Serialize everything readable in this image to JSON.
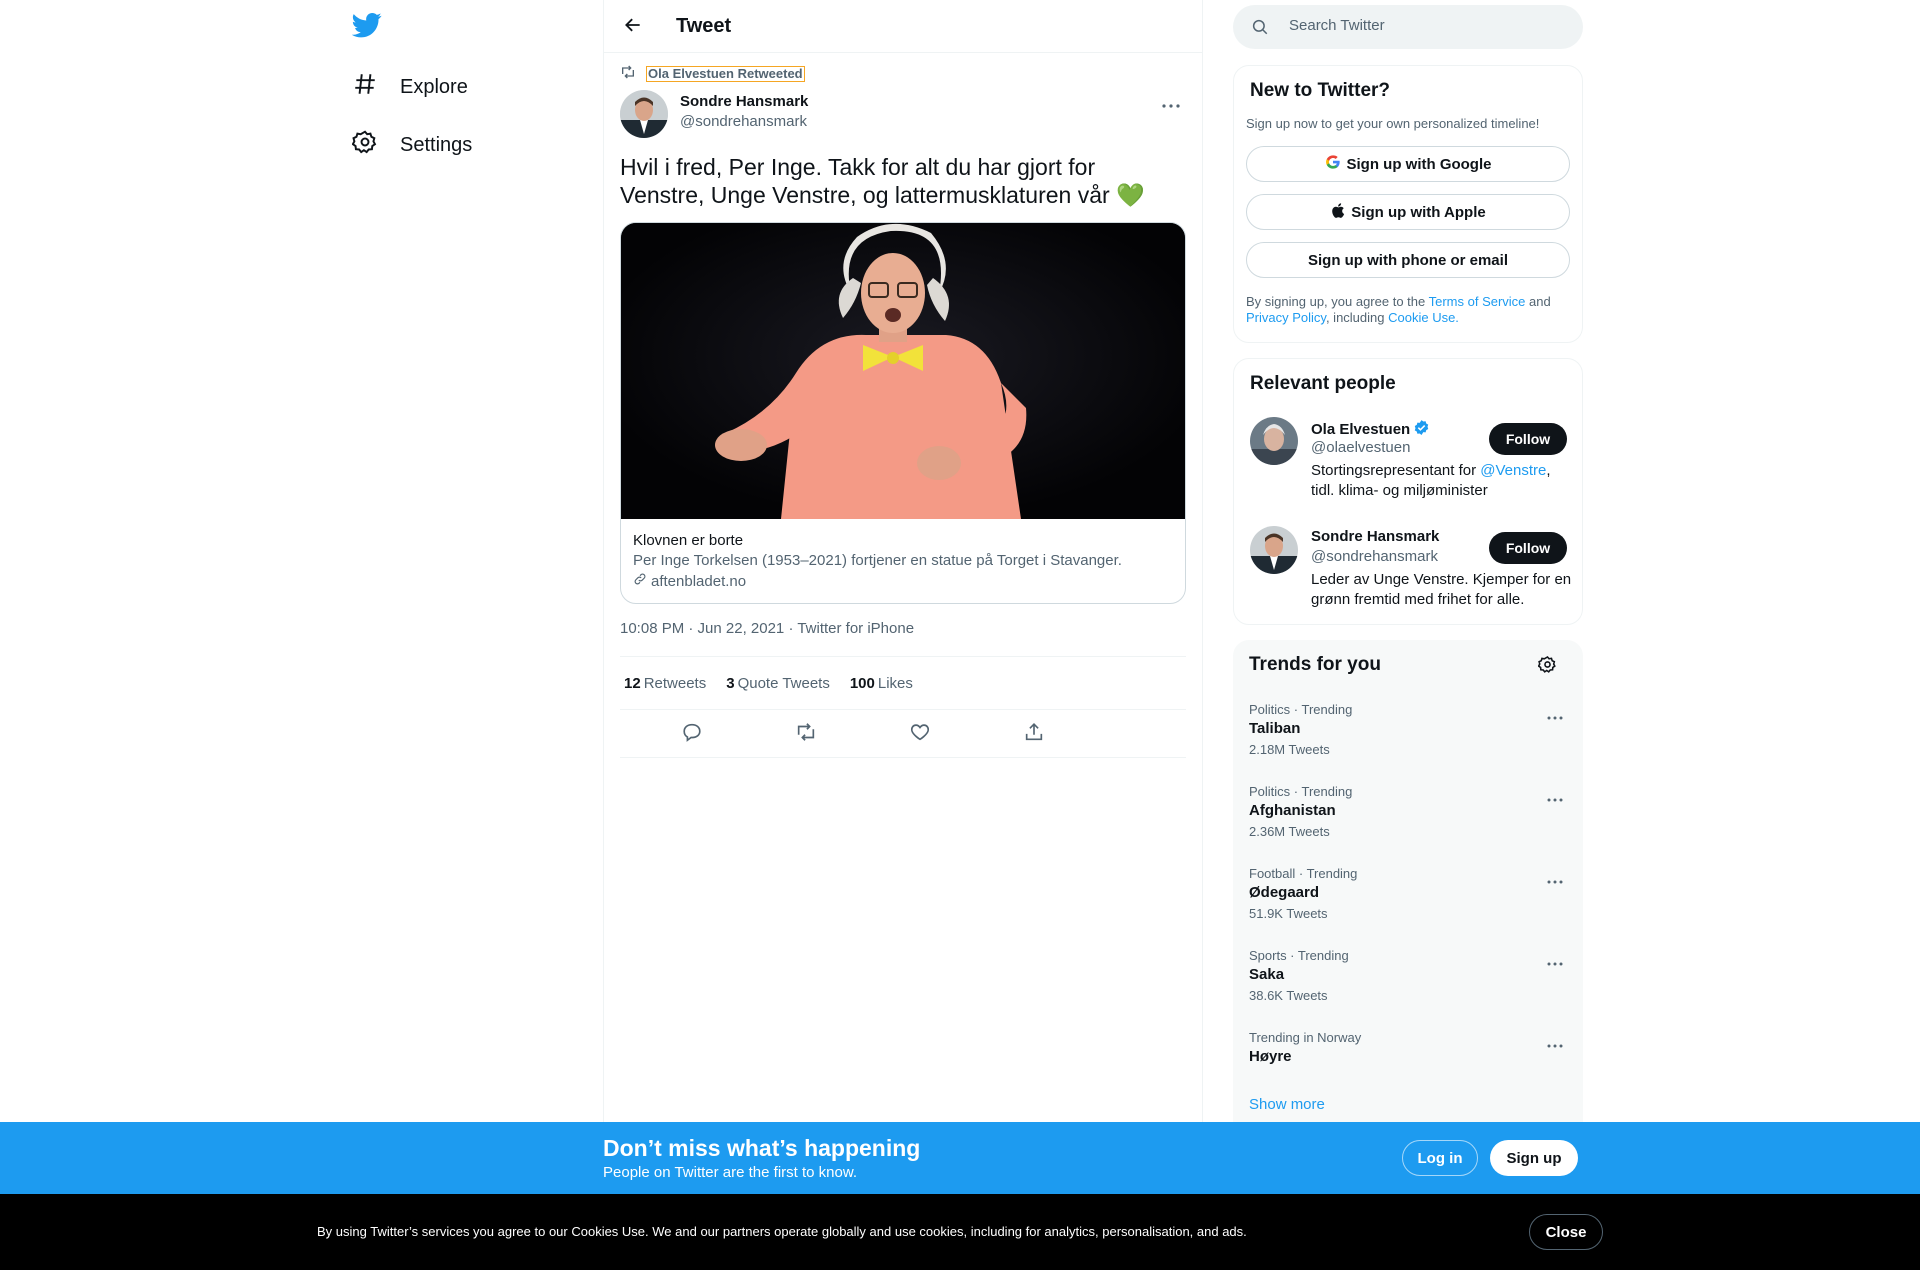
{
  "nav": {
    "explore_label": "Explore",
    "settings_label": "Settings"
  },
  "header": {
    "title": "Tweet"
  },
  "tweet": {
    "retweeted_by": "Ola Elvestuen Retweeted",
    "author_name": "Sondre Hansmark",
    "author_handle": "@sondrehansmark",
    "text": "Hvil i fred, Per Inge. Takk for alt du har gjort for Venstre, Unge Venstre, og lattermusklaturen vår",
    "emoji": "💚",
    "card": {
      "title": "Klovnen er borte",
      "description": "Per Inge Torkelsen (1953–2021) fortjener en statue på Torget i Stavanger.",
      "domain": "aftenbladet.no"
    },
    "timestamp": "10:08 PM · Jun 22, 2021 · Twitter for iPhone",
    "stats": {
      "retweets_count": "12",
      "retweets_label": "Retweets",
      "quotes_count": "3",
      "quotes_label": "Quote Tweets",
      "likes_count": "100",
      "likes_label": "Likes"
    }
  },
  "search": {
    "placeholder": "Search Twitter"
  },
  "new_to_twitter": {
    "title": "New to Twitter?",
    "subtitle": "Sign up now to get your own personalized timeline!",
    "google_btn": "Sign up with Google",
    "apple_btn": "Sign up with Apple",
    "phone_btn": "Sign up with phone or email",
    "terms_pre": "By signing up, you agree to the ",
    "terms_link": "Terms of Service",
    "terms_and": " and",
    "privacy_link": "Privacy Policy",
    "including": ", including ",
    "cookie_link": "Cookie Use."
  },
  "relevant_people": {
    "title": "Relevant people",
    "people": [
      {
        "name": "Ola Elvestuen",
        "handle": "@olaelvestuen",
        "bio_pre": "Stortingsrepresentant for ",
        "bio_link": "@Venstre",
        "bio_post": ", tidl. klima- og miljøminister",
        "follow": "Follow"
      },
      {
        "name": "Sondre Hansmark",
        "handle": "@sondrehansmark",
        "bio": "Leder av Unge Venstre. Kjemper for en grønn fremtid med frihet for alle.",
        "follow": "Follow"
      }
    ]
  },
  "trends": {
    "title": "Trends for you",
    "items": [
      {
        "meta": "Politics · Trending",
        "name": "Taliban",
        "count": "2.18M Tweets"
      },
      {
        "meta": "Politics · Trending",
        "name": "Afghanistan",
        "count": "2.36M Tweets"
      },
      {
        "meta": "Football · Trending",
        "name": "Ødegaard",
        "count": "51.9K Tweets"
      },
      {
        "meta": "Sports · Trending",
        "name": "Saka",
        "count": "38.6K Tweets"
      },
      {
        "meta": "Trending in Norway",
        "name": "Høyre",
        "count": ""
      }
    ],
    "show_more": "Show more"
  },
  "bottom_bar": {
    "title": "Don’t miss what’s happening",
    "subtitle": "People on Twitter are the first to know.",
    "login": "Log in",
    "signup": "Sign up"
  },
  "cookie_bar": {
    "text": "By using Twitter’s services you agree to our Cookies Use. We and our partners operate globally and use cookies, including for analytics, personalisation, and ads.",
    "close": "Close"
  },
  "colors": {
    "accent": "#1d9bf0",
    "text": "#0f1419",
    "secondary": "#536471",
    "highlight_border": "#f5a623"
  }
}
